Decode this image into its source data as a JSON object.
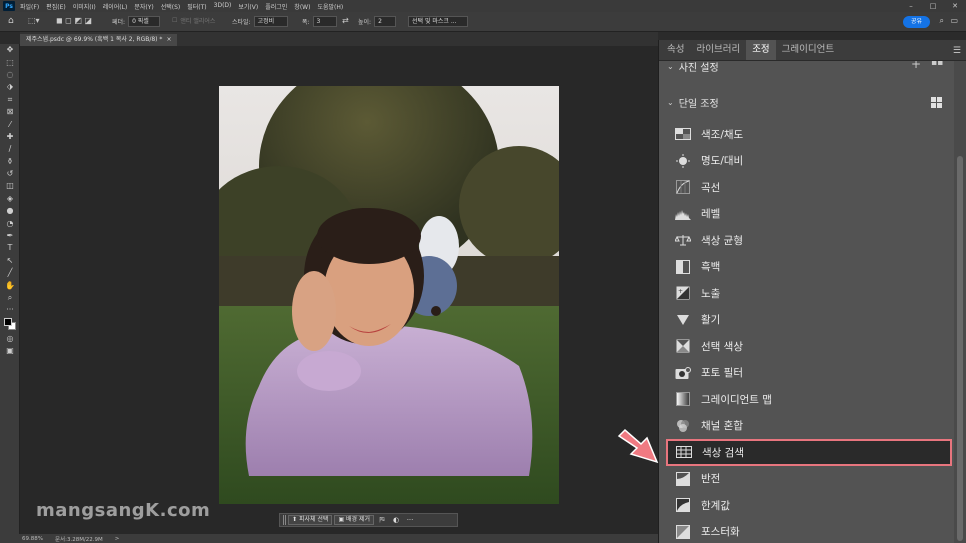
{
  "app": {
    "logo": "Ps"
  },
  "menu": [
    "파일(F)",
    "편집(E)",
    "이미지(I)",
    "레이어(L)",
    "문자(Y)",
    "선택(S)",
    "필터(T)",
    "3D(D)",
    "보기(V)",
    "플러그인",
    "창(W)",
    "도움말(H)"
  ],
  "options_bar": {
    "feather_label": "페더:",
    "feather_value": "0 픽셀",
    "antialias_label": "앤티 앨리어스",
    "style_label": "스타일:",
    "style_value": "고정비",
    "width_label": "폭:",
    "width_value": "3",
    "height_label": "높이:",
    "height_value": "2",
    "select_mask_button": "선택 및 마스크 ...",
    "share_button": "공유"
  },
  "document_tab": {
    "title": "제주스냅.psdc @ 69.9% (흑백 1 복사 2, RGB/8) *",
    "close": "×"
  },
  "contextual_bar": {
    "select_subject": "피사체 선택",
    "remove_bg": "배경 제거",
    "more": "···"
  },
  "status_bar": {
    "zoom": "69.88%",
    "doc_info": "문서:3.28M/22.9M",
    "arrow": ">"
  },
  "watermark": "mangsangK.com",
  "panel": {
    "tabs": [
      {
        "label": "속성",
        "active": false
      },
      {
        "label": "라이브러리",
        "active": false
      },
      {
        "label": "조정",
        "active": true
      },
      {
        "label": "그레이디언트",
        "active": false
      }
    ],
    "partial_section": "사진 설정",
    "section_title": "단일 조정",
    "items": [
      {
        "label": "색조/채도",
        "icon": "hue-saturation-icon"
      },
      {
        "label": "명도/대비",
        "icon": "brightness-contrast-icon"
      },
      {
        "label": "곡선",
        "icon": "curves-icon"
      },
      {
        "label": "레벨",
        "icon": "levels-icon"
      },
      {
        "label": "색상 균형",
        "icon": "color-balance-icon"
      },
      {
        "label": "흑백",
        "icon": "black-white-icon"
      },
      {
        "label": "노출",
        "icon": "exposure-icon"
      },
      {
        "label": "활기",
        "icon": "vibrance-icon"
      },
      {
        "label": "선택 색상",
        "icon": "selective-color-icon"
      },
      {
        "label": "포토 필터",
        "icon": "photo-filter-icon"
      },
      {
        "label": "그레이디언트 맵",
        "icon": "gradient-map-icon"
      },
      {
        "label": "채널 혼합",
        "icon": "channel-mixer-icon"
      },
      {
        "label": "색상 검색",
        "icon": "color-lookup-icon",
        "selected": true
      },
      {
        "label": "반전",
        "icon": "invert-icon"
      },
      {
        "label": "한계값",
        "icon": "threshold-icon"
      },
      {
        "label": "포스터화",
        "icon": "posterize-icon"
      }
    ],
    "highlight_color": "#e8757e"
  }
}
